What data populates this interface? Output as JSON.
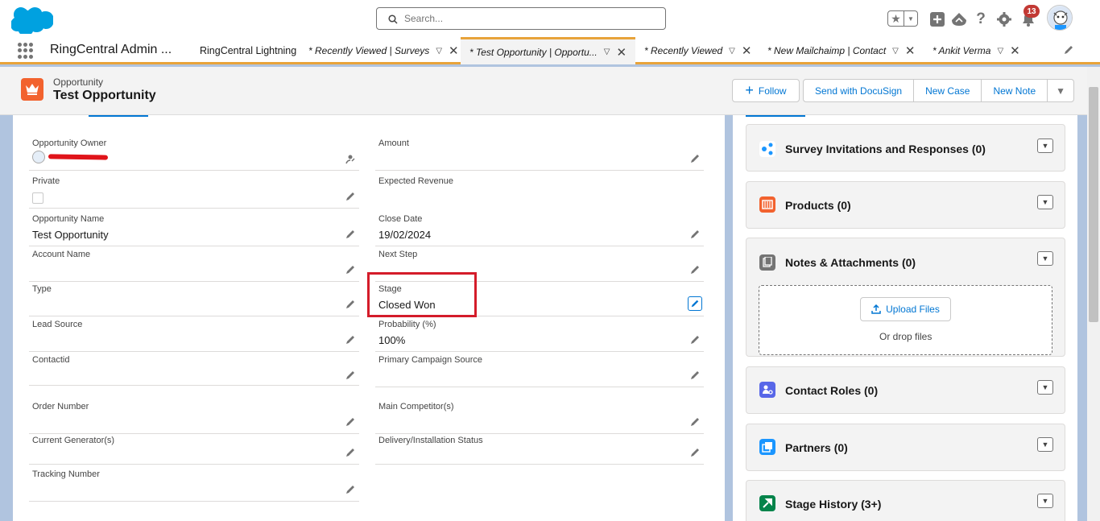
{
  "global_header": {
    "search_placeholder": "Search...",
    "notification_count": "13"
  },
  "nav": {
    "app_name": "RingCentral Admin ...",
    "home_item": "RingCentral Lightning",
    "tabs": [
      {
        "label": "* Recently Viewed | Surveys"
      },
      {
        "label": "* Test Opportunity | Opportu..."
      },
      {
        "label": "* Recently Viewed"
      },
      {
        "label": "* New Mailchaimp | Contact"
      },
      {
        "label": "* Ankit Verma"
      }
    ]
  },
  "record": {
    "object_type": "Opportunity",
    "name": "Test Opportunity",
    "actions": {
      "follow": "Follow",
      "docusign": "Send with DocuSign",
      "new_case": "New Case",
      "new_note": "New Note"
    }
  },
  "fields": {
    "opportunity_owner": {
      "label": "Opportunity Owner"
    },
    "amount": {
      "label": "Amount",
      "value": ""
    },
    "private": {
      "label": "Private"
    },
    "expected_revenue": {
      "label": "Expected Revenue",
      "value": ""
    },
    "opportunity_name": {
      "label": "Opportunity Name",
      "value": "Test Opportunity"
    },
    "close_date": {
      "label": "Close Date",
      "value": "19/02/2024"
    },
    "account_name": {
      "label": "Account Name",
      "value": ""
    },
    "next_step": {
      "label": "Next Step",
      "value": ""
    },
    "type": {
      "label": "Type",
      "value": ""
    },
    "stage": {
      "label": "Stage",
      "value": "Closed Won"
    },
    "lead_source": {
      "label": "Lead Source",
      "value": ""
    },
    "probability": {
      "label": "Probability (%)",
      "value": "100%"
    },
    "contactid": {
      "label": "Contactid",
      "value": ""
    },
    "primary_campaign_source": {
      "label": "Primary Campaign Source",
      "value": ""
    },
    "order_number": {
      "label": "Order Number",
      "value": ""
    },
    "main_competitors": {
      "label": "Main Competitor(s)",
      "value": ""
    },
    "current_generators": {
      "label": "Current Generator(s)",
      "value": ""
    },
    "delivery_installation_status": {
      "label": "Delivery/Installation Status",
      "value": ""
    },
    "tracking_number": {
      "label": "Tracking Number",
      "value": ""
    }
  },
  "related": {
    "survey": "Survey Invitations and Responses (0)",
    "products": "Products (0)",
    "notes": "Notes & Attachments (0)",
    "upload_files": "Upload Files",
    "drop_files": "Or drop files",
    "contact_roles": "Contact Roles (0)",
    "partners": "Partners (0)",
    "stage_history": "Stage History (3+)"
  },
  "colors": {
    "brand_blue": "#0176d3",
    "opportunity_orange": "#f2622e",
    "highlight_red": "#d41c2a",
    "nav_accent": "#e8a33a"
  }
}
